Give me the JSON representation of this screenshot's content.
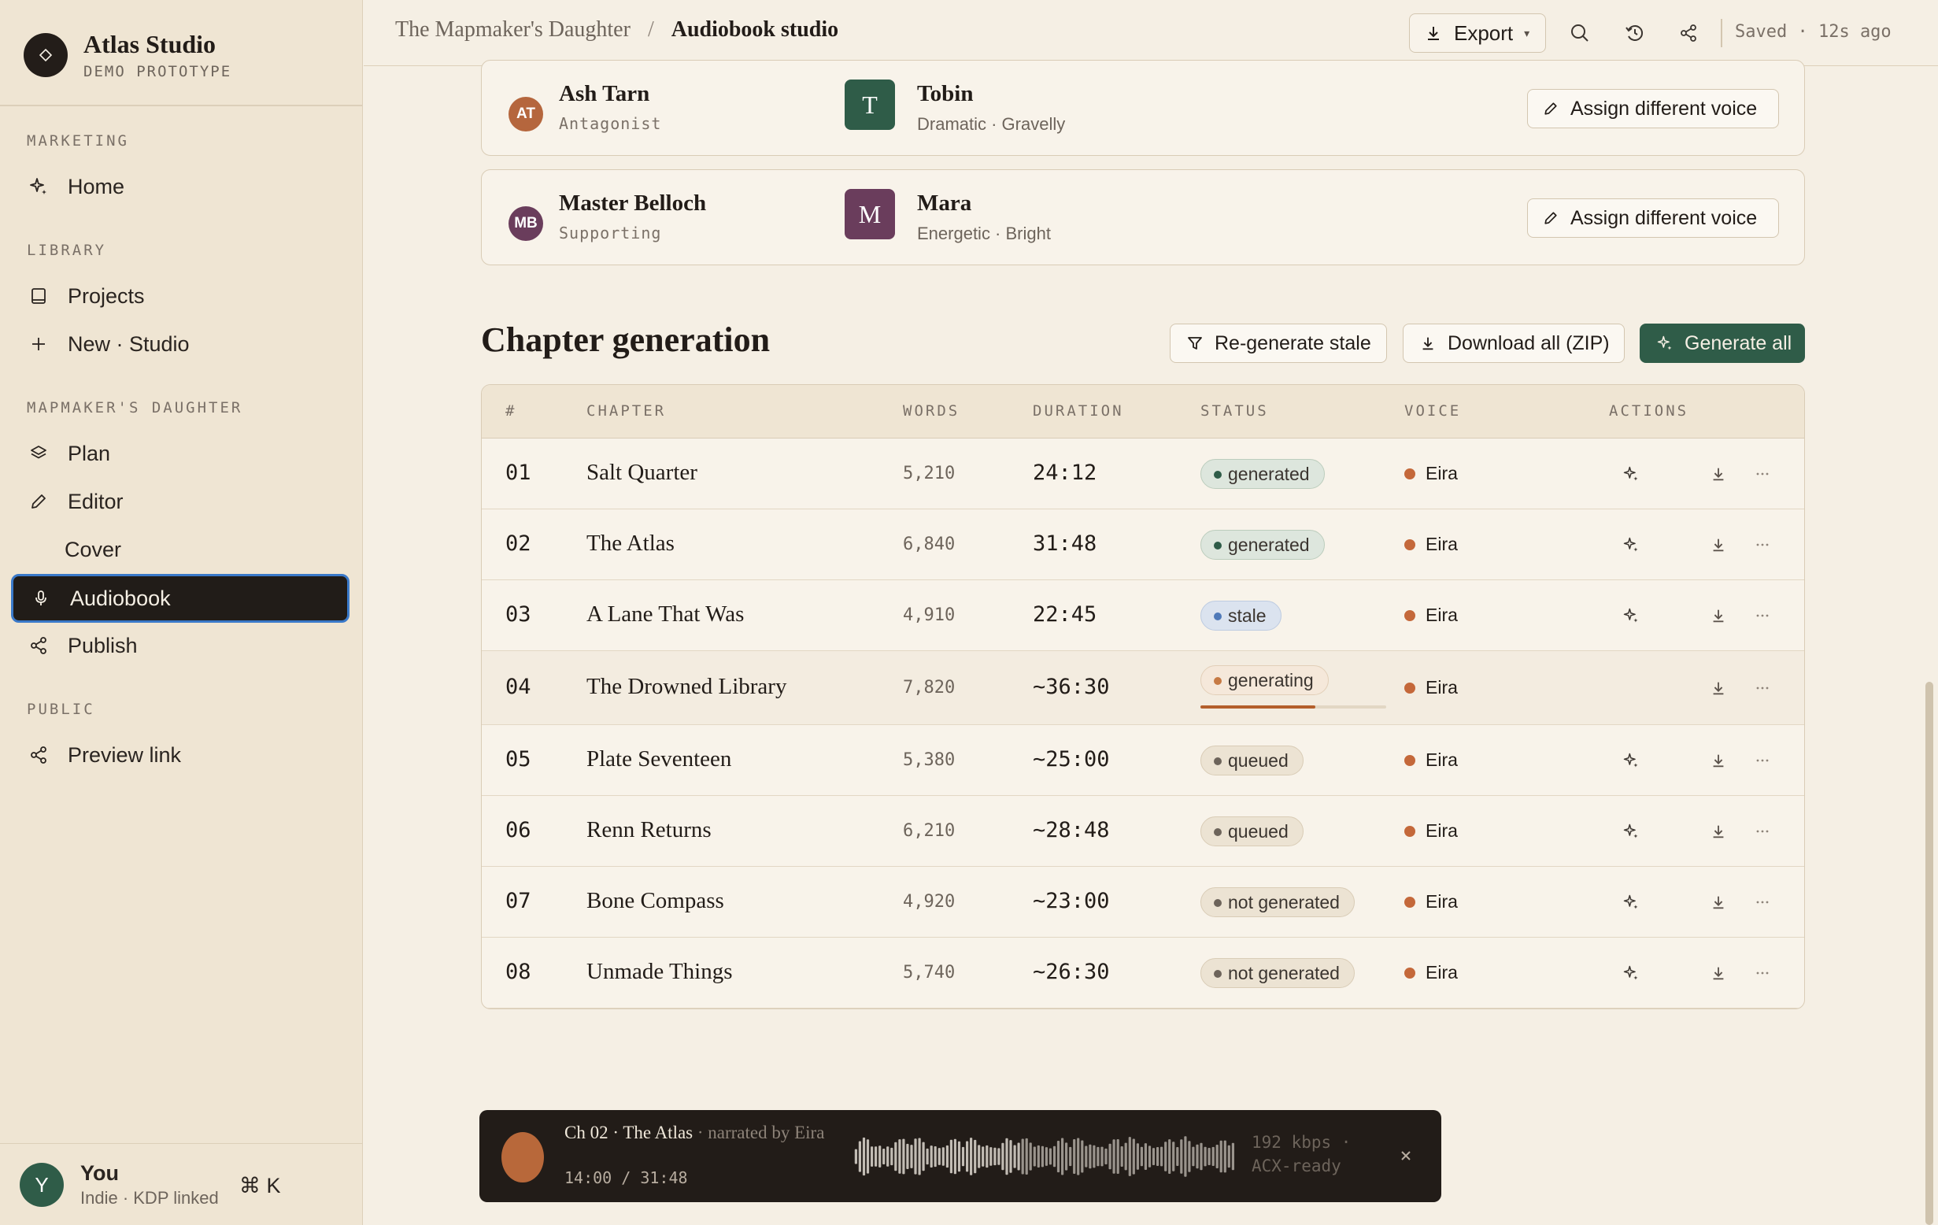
{
  "brand": {
    "name": "Atlas Studio",
    "subtitle": "DEMO PROTOTYPE"
  },
  "sidebar": {
    "sections": [
      {
        "label": "MARKETING"
      },
      {
        "label": "LIBRARY"
      },
      {
        "label": "MAPMAKER'S DAUGHTER"
      },
      {
        "label": "PUBLIC"
      }
    ],
    "items": [
      {
        "label": "Home",
        "icon": "sparkle-icon"
      },
      {
        "label": "Projects",
        "icon": "book-icon"
      },
      {
        "label": "New · Studio",
        "icon": "plus-icon"
      },
      {
        "label": "Plan",
        "icon": "layers-icon"
      },
      {
        "label": "Editor",
        "icon": "pencil-icon"
      },
      {
        "label": "Cover",
        "icon": ""
      },
      {
        "label": "Audiobook",
        "icon": "mic-icon",
        "active": true
      },
      {
        "label": "Publish",
        "icon": "share-icon"
      },
      {
        "label": "Preview link",
        "icon": "share-icon"
      }
    ],
    "user": {
      "initial": "Y",
      "name": "You",
      "plan": "Indie · KDP linked",
      "shortcut": "⌘ K"
    }
  },
  "header": {
    "breadcrumb": [
      "The Mapmaker's Daughter",
      "Audiobook studio"
    ],
    "export_label": "Export",
    "saved_text": "Saved · 12s ago"
  },
  "voice_cards": [
    {
      "initials": "AT",
      "name": "Ash Tarn",
      "role": "Antagonist",
      "avatar_color": "#b5663d",
      "voice_letter": "T",
      "voice_name": "Tobin",
      "voice_desc": "Dramatic · Gravelly",
      "voice_color": "#2f5c48",
      "assign_label": "Assign different voice"
    },
    {
      "initials": "MB",
      "name": "Master Belloch",
      "role": "Supporting",
      "avatar_color": "#6a3d5c",
      "voice_letter": "M",
      "voice_name": "Mara",
      "voice_desc": "Energetic · Bright",
      "voice_color": "#6a3d5c",
      "assign_label": "Assign different voice"
    }
  ],
  "chapter_generation": {
    "title": "Chapter generation",
    "actions": {
      "regenerate": "Re-generate stale",
      "download": "Download all (ZIP)",
      "generate": "Generate all"
    },
    "columns": [
      "#",
      "CHAPTER",
      "WORDS",
      "DURATION",
      "STATUS",
      "VOICE",
      "ACTIONS"
    ],
    "rows": [
      {
        "num": "01",
        "title": "Salt Quarter",
        "words": "5,210",
        "duration": "24:12",
        "status": "generated",
        "voice": "Eira"
      },
      {
        "num": "02",
        "title": "The Atlas",
        "words": "6,840",
        "duration": "31:48",
        "status": "generated",
        "voice": "Eira"
      },
      {
        "num": "03",
        "title": "A Lane That Was",
        "words": "4,910",
        "duration": "22:45",
        "status": "stale",
        "voice": "Eira"
      },
      {
        "num": "04",
        "title": "The Drowned Library",
        "words": "7,820",
        "duration": "~36:30",
        "status": "generating",
        "voice": "Eira",
        "progress": 0.62
      },
      {
        "num": "05",
        "title": "Plate Seventeen",
        "words": "5,380",
        "duration": "~25:00",
        "status": "queued",
        "voice": "Eira"
      },
      {
        "num": "06",
        "title": "Renn Returns",
        "words": "6,210",
        "duration": "~28:48",
        "status": "queued",
        "voice": "Eira"
      },
      {
        "num": "07",
        "title": "Bone Compass",
        "words": "4,920",
        "duration": "~23:00",
        "status": "not generated",
        "voice": "Eira"
      },
      {
        "num": "08",
        "title": "Unmade Things",
        "words": "5,740",
        "duration": "~26:30",
        "status": "not generated",
        "voice": "Eira"
      }
    ]
  },
  "player": {
    "title": "Ch 02 · The Atlas",
    "subtitle": " · narrated by Eira",
    "time": "14:00 / 31:48",
    "bitrate": "192 kbps ·",
    "quality": "ACX-ready",
    "progress": 0.44
  }
}
